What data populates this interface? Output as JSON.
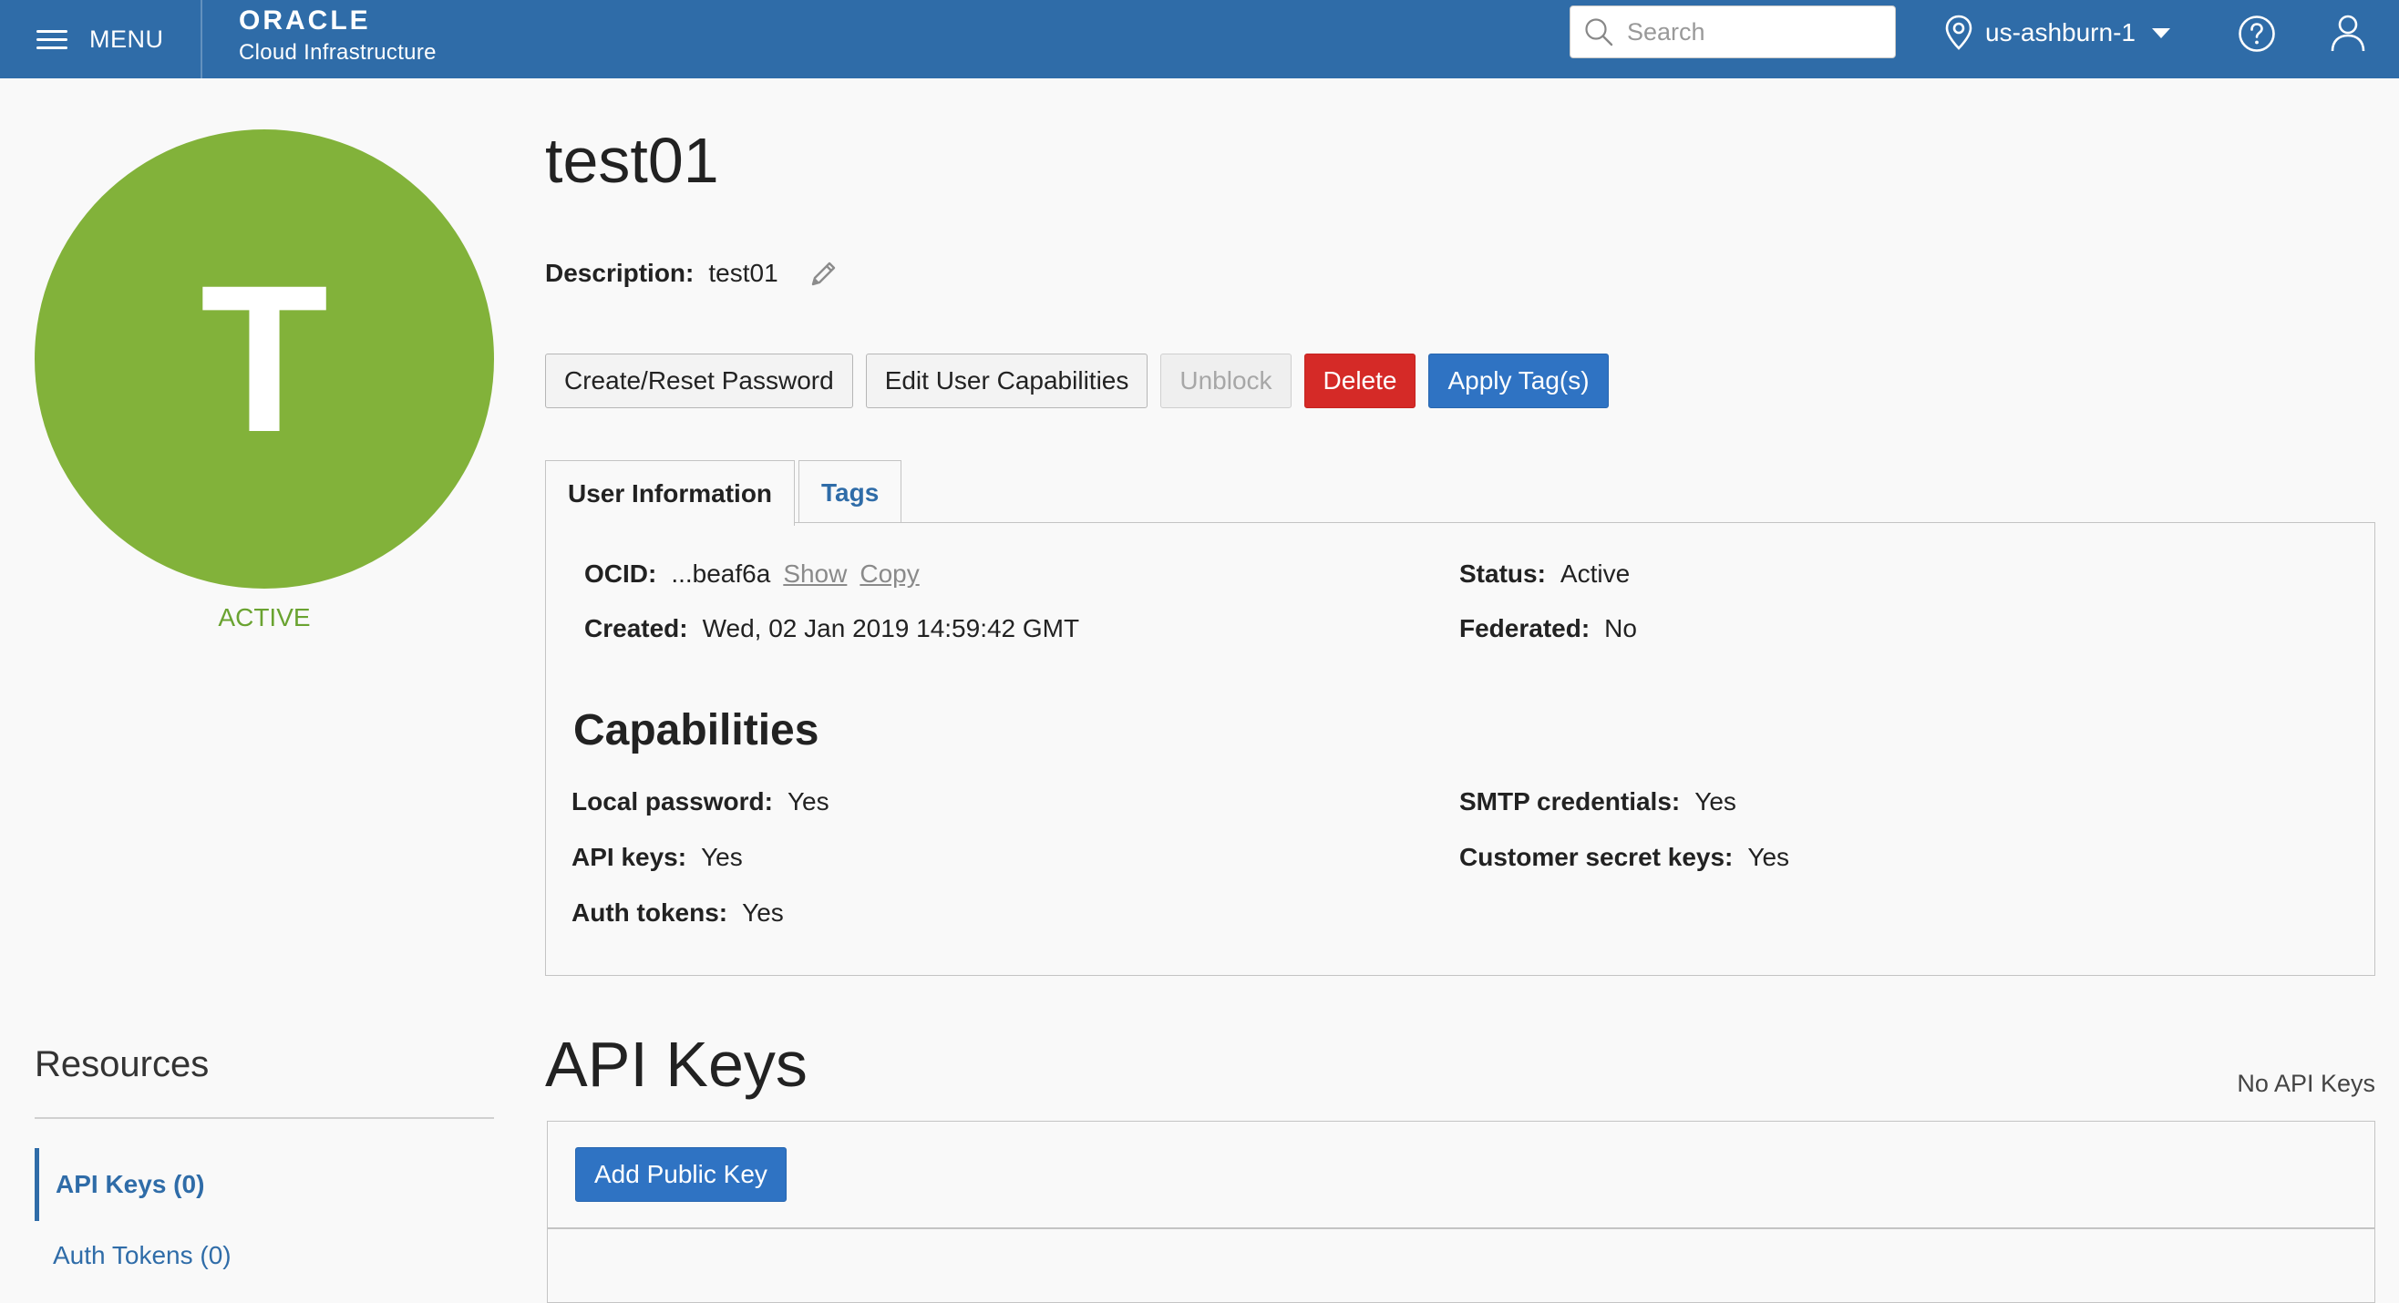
{
  "header": {
    "menu_label": "MENU",
    "brand_name": "ORACLE",
    "brand_sub": "Cloud Infrastructure",
    "search_placeholder": "Search",
    "region": "us-ashburn-1",
    "bar_color": "#2f6ca8"
  },
  "user": {
    "avatar_initial": "T",
    "avatar_color": "#82b23a",
    "status_label": "ACTIVE",
    "name": "test01",
    "description_label": "Description:",
    "description": "test01"
  },
  "actions": {
    "create_reset_password": "Create/Reset Password",
    "edit_capabilities": "Edit User Capabilities",
    "unblock": "Unblock",
    "delete": "Delete",
    "apply_tags": "Apply Tag(s)"
  },
  "tabs": [
    "User Information",
    "Tags"
  ],
  "info": {
    "ocid_label": "OCID:",
    "ocid_value": "...beaf6a",
    "show_link": "Show",
    "copy_link": "Copy",
    "created_label": "Created:",
    "created_value": "Wed, 02 Jan 2019 14:59:42 GMT",
    "status_label": "Status:",
    "status_value": "Active",
    "federated_label": "Federated:",
    "federated_value": "No"
  },
  "capabilities": {
    "title": "Capabilities",
    "local_password_label": "Local password:",
    "local_password_value": "Yes",
    "api_keys_label": "API keys:",
    "api_keys_value": "Yes",
    "auth_tokens_label": "Auth tokens:",
    "auth_tokens_value": "Yes",
    "smtp_label": "SMTP credentials:",
    "smtp_value": "Yes",
    "customer_secret_label": "Customer secret keys:",
    "customer_secret_value": "Yes"
  },
  "resources": {
    "title": "Resources",
    "items": [
      "API Keys (0)",
      "Auth Tokens (0)"
    ]
  },
  "api_keys": {
    "title": "API Keys",
    "empty_text": "No API Keys",
    "add_button": "Add Public Key"
  }
}
